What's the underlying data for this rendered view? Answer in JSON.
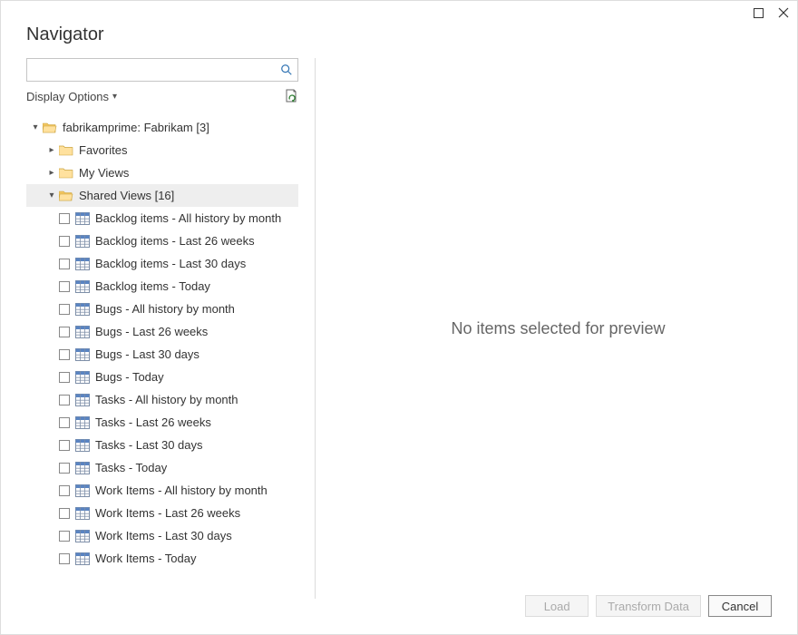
{
  "title": "Navigator",
  "window": {
    "maximize_icon": "maximize-icon",
    "close_icon": "close-icon"
  },
  "search": {
    "value": ""
  },
  "display_options_label": "Display Options",
  "tree": {
    "root": {
      "label": "fabrikamprime: Fabrikam [3]",
      "expanded": true,
      "children": [
        {
          "kind": "folder",
          "label": "Favorites",
          "expanded": false
        },
        {
          "kind": "folder",
          "label": "My Views",
          "expanded": false
        },
        {
          "kind": "folder",
          "label": "Shared Views [16]",
          "expanded": true,
          "selected": true,
          "items": [
            {
              "label": "Backlog items - All history by month"
            },
            {
              "label": "Backlog items - Last 26 weeks"
            },
            {
              "label": "Backlog items - Last 30 days"
            },
            {
              "label": "Backlog items - Today"
            },
            {
              "label": "Bugs - All history by month"
            },
            {
              "label": "Bugs - Last 26 weeks"
            },
            {
              "label": "Bugs - Last 30 days"
            },
            {
              "label": "Bugs - Today"
            },
            {
              "label": "Tasks - All history by month"
            },
            {
              "label": "Tasks - Last 26 weeks"
            },
            {
              "label": "Tasks - Last 30 days"
            },
            {
              "label": "Tasks - Today"
            },
            {
              "label": "Work Items - All history by month"
            },
            {
              "label": "Work Items - Last 26 weeks"
            },
            {
              "label": "Work Items - Last 30 days"
            },
            {
              "label": "Work Items - Today"
            }
          ]
        }
      ]
    }
  },
  "preview_placeholder": "No items selected for preview",
  "footer": {
    "load_label": "Load",
    "transform_label": "Transform Data",
    "cancel_label": "Cancel"
  }
}
